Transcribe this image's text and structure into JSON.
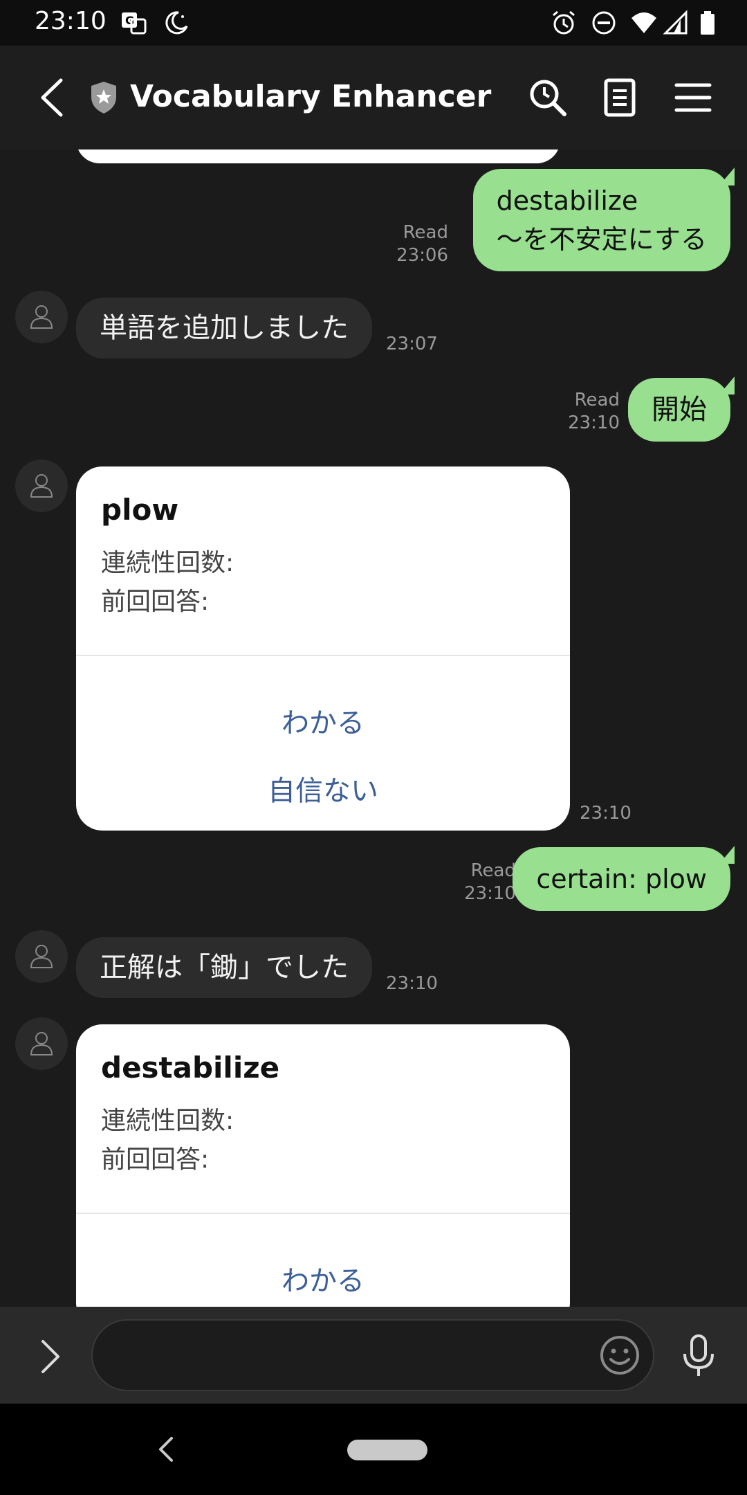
{
  "status_bar": {
    "time": "23:10",
    "left_icons": [
      "translate-icon",
      "night-mode-icon"
    ],
    "right_icons": [
      "alarm-icon",
      "do-not-disturb-icon",
      "wifi-icon",
      "signal-icon",
      "battery-icon"
    ]
  },
  "header": {
    "title": "Vocabulary Enhancer",
    "icons": [
      "back-arrow-icon",
      "shield-star-icon",
      "search-icon",
      "notes-icon",
      "menu-icon"
    ]
  },
  "messages": [
    {
      "type": "outgoing",
      "lines": [
        "destabilize",
        "〜を不安定にする"
      ],
      "status": "Read",
      "time": "23:06"
    },
    {
      "type": "incoming",
      "text": "単語を追加しました",
      "time": "23:07"
    },
    {
      "type": "outgoing",
      "lines": [
        "開始"
      ],
      "status": "Read",
      "time": "23:10"
    },
    {
      "type": "card",
      "word": "plow",
      "field1": "連続性回数:",
      "field2": "前回回答:",
      "buttons": [
        "わかる",
        "自信ない"
      ],
      "time": "23:10"
    },
    {
      "type": "outgoing",
      "lines": [
        "certain: plow"
      ],
      "status": "Read",
      "time": "23:10"
    },
    {
      "type": "incoming",
      "text": "正解は「鋤」でした",
      "time": "23:10"
    },
    {
      "type": "card",
      "word": "destabilize",
      "field1": "連続性回数:",
      "field2": "前回回答:",
      "buttons": [
        "わかる"
      ]
    }
  ],
  "input": {
    "value": "",
    "icons": [
      "expand-icon",
      "emoji-icon",
      "microphone-icon"
    ]
  },
  "colors": {
    "outgoing_bubble": "#98e08f",
    "incoming_bubble": "#2c2c2c",
    "background": "#1b1b1b",
    "card_button_text": "#3c5f98"
  }
}
